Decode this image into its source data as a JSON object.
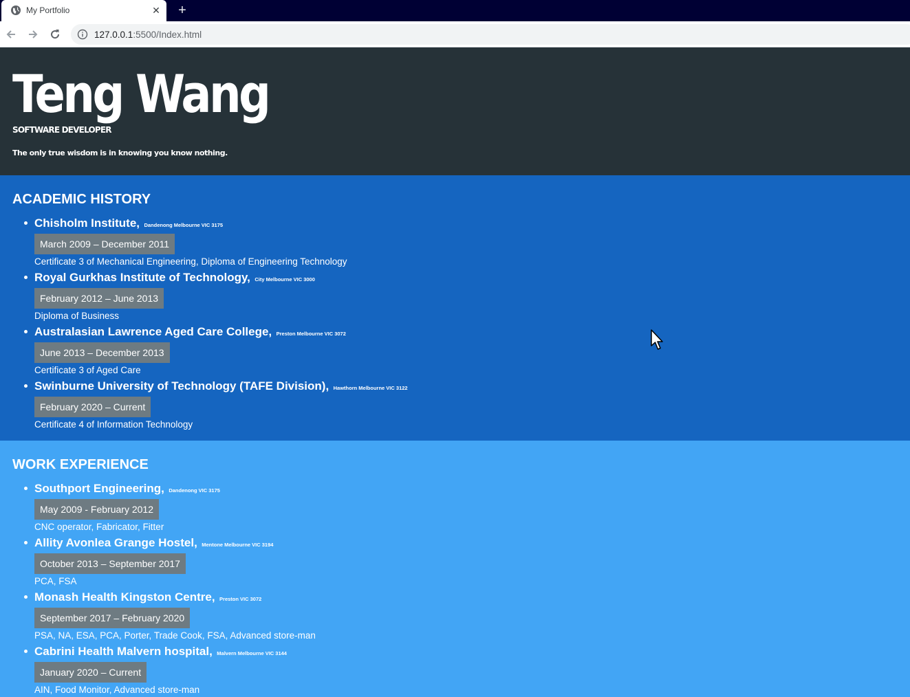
{
  "browser": {
    "tab_title": "My Portfolio",
    "new_tab_symbol": "+",
    "close_symbol": "✕",
    "url_host": "127.0.0.1",
    "url_path": ":5500/Index.html"
  },
  "hero": {
    "name": "Teng Wang",
    "role": "SOFTWARE DEVELOPER",
    "quote": "The only true wisdom is in knowing you know nothing."
  },
  "academic": {
    "title": "ACADEMIC HISTORY",
    "entries": [
      {
        "name": "Chisholm Institute,",
        "location": "Dandenong Melbourne VIC 3175",
        "dates": "March 2009 – December 2011",
        "desc": "Certificate 3 of Mechanical Engineering, Diploma of Engineering Technology"
      },
      {
        "name": "Royal Gurkhas Institute of Technology,",
        "location": "City Melbourne VIC 3000",
        "dates": "February 2012 – June 2013",
        "desc": "Diploma of Business"
      },
      {
        "name": "Australasian Lawrence Aged Care College,",
        "location": "Preston Melbourne VIC 3072",
        "dates": "June 2013 – December 2013",
        "desc": "Certificate 3 of Aged Care"
      },
      {
        "name": "Swinburne University of Technology (TAFE Division),",
        "location": "Hawthorn Melbourne VIC 3122",
        "dates": "February 2020 – Current",
        "desc": "Certificate 4 of Information Technology"
      }
    ]
  },
  "work": {
    "title": "WORK EXPERIENCE",
    "entries": [
      {
        "name": "Southport Engineering,",
        "location": "Dandenong VIC 3175",
        "dates": "May 2009 - February 2012",
        "desc": "CNC operator, Fabricator, Fitter"
      },
      {
        "name": "Allity Avonlea Grange Hostel,",
        "location": "Mentone Melbourne VIC 3194",
        "dates": "October 2013 – September 2017",
        "desc": "PCA, FSA"
      },
      {
        "name": "Monash Health Kingston Centre,",
        "location": "Preston VIC 3072",
        "dates": "September 2017 – February 2020",
        "desc": "PSA, NA, ESA, PCA, Porter, Trade Cook, FSA, Advanced store-man"
      },
      {
        "name": "Cabrini Health Malvern hospital,",
        "location": "Malvern Melbourne VIC 3144",
        "dates": "January 2020 – Current",
        "desc": "AIN, Food Monitor, Advanced store-man"
      }
    ]
  },
  "colors": {
    "hero_bg": "#263238",
    "academic_bg": "#1565c0",
    "work_bg": "#42a5f5",
    "badge_bg": "#6e7b82"
  }
}
